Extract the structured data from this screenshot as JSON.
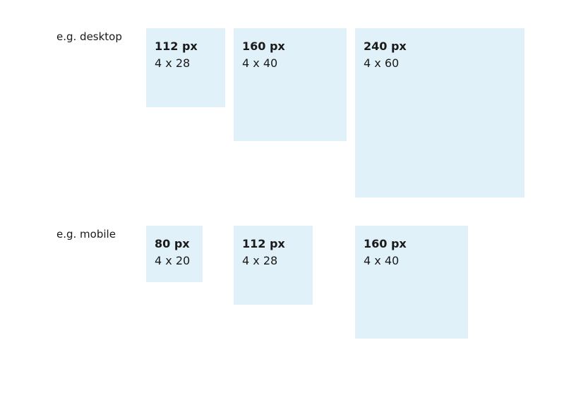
{
  "rows": {
    "desktop": {
      "label": "e.g. desktop",
      "boxes": [
        {
          "size": "112 px",
          "formula": "4 x 28"
        },
        {
          "size": "160 px",
          "formula": "4 x 40"
        },
        {
          "size": "240 px",
          "formula": "4 x 60"
        }
      ]
    },
    "mobile": {
      "label": "e.g. mobile",
      "boxes": [
        {
          "size": "80 px",
          "formula": "4 x 20"
        },
        {
          "size": "112 px",
          "formula": "4 x 28"
        },
        {
          "size": "160 px",
          "formula": "4 x 40"
        }
      ]
    }
  },
  "colors": {
    "box_fill": "#e1f1f9",
    "text": "#1a1a1a"
  }
}
